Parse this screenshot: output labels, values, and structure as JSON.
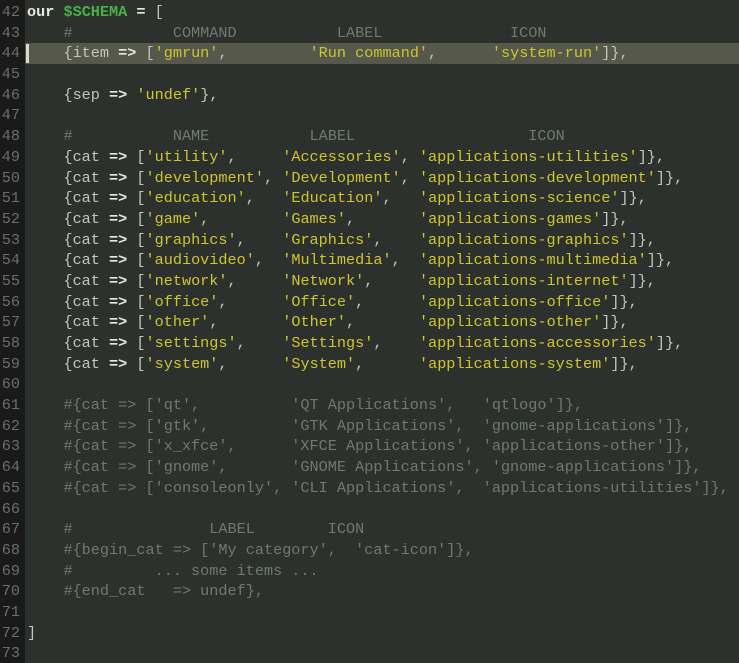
{
  "editor": {
    "current_line": "44",
    "colors": {
      "bg": "#2d312e",
      "gutter_bg": "#1a1a1a",
      "line_number": "#6b6f66",
      "default_text": "#c3c6ba",
      "keyword": "#e6e8de",
      "green_variable": "#46b246",
      "string_yellow": "#cfc52f",
      "comment": "#6f796f",
      "current_line_bg": "#55584a",
      "cursor": "#d9d9d2"
    },
    "lines": [
      {
        "num": "42",
        "segs": [
          [
            "our",
            "kw"
          ],
          [
            " ",
            ""
          ],
          [
            "$SCHEMA",
            "var"
          ],
          [
            " ",
            ""
          ],
          [
            "=",
            "kw"
          ],
          [
            " [",
            ""
          ]
        ]
      },
      {
        "num": "43",
        "segs": [
          [
            "    #           COMMAND           LABEL              ICON",
            "com"
          ]
        ]
      },
      {
        "num": "44",
        "segs": [
          [
            "    {item ",
            ""
          ],
          [
            "=>",
            "kw"
          ],
          [
            " [",
            ""
          ],
          [
            "'gmrun'",
            "str"
          ],
          [
            ",         ",
            ""
          ],
          [
            "'Run command'",
            "str"
          ],
          [
            ",      ",
            ""
          ],
          [
            "'system-run'",
            "str"
          ],
          [
            "]},",
            ""
          ]
        ]
      },
      {
        "num": "45",
        "segs": []
      },
      {
        "num": "46",
        "segs": [
          [
            "    {sep ",
            ""
          ],
          [
            "=>",
            "kw"
          ],
          [
            " ",
            ""
          ],
          [
            "'undef'",
            "str"
          ],
          [
            "},",
            ""
          ]
        ]
      },
      {
        "num": "47",
        "segs": []
      },
      {
        "num": "48",
        "segs": [
          [
            "    #           NAME           LABEL                   ICON",
            "com"
          ]
        ]
      },
      {
        "num": "49",
        "segs": [
          [
            "    {cat ",
            ""
          ],
          [
            "=>",
            "kw"
          ],
          [
            " [",
            ""
          ],
          [
            "'utility'",
            "str"
          ],
          [
            ",     ",
            ""
          ],
          [
            "'Accessories'",
            "str"
          ],
          [
            ", ",
            ""
          ],
          [
            "'applications-utilities'",
            "str"
          ],
          [
            "]},",
            ""
          ]
        ]
      },
      {
        "num": "50",
        "segs": [
          [
            "    {cat ",
            ""
          ],
          [
            "=>",
            "kw"
          ],
          [
            " [",
            ""
          ],
          [
            "'development'",
            "str"
          ],
          [
            ", ",
            ""
          ],
          [
            "'Development'",
            "str"
          ],
          [
            ", ",
            ""
          ],
          [
            "'applications-development'",
            "str"
          ],
          [
            "]},",
            ""
          ]
        ]
      },
      {
        "num": "51",
        "segs": [
          [
            "    {cat ",
            ""
          ],
          [
            "=>",
            "kw"
          ],
          [
            " [",
            ""
          ],
          [
            "'education'",
            "str"
          ],
          [
            ",   ",
            ""
          ],
          [
            "'Education'",
            "str"
          ],
          [
            ",   ",
            ""
          ],
          [
            "'applications-science'",
            "str"
          ],
          [
            "]},",
            ""
          ]
        ]
      },
      {
        "num": "52",
        "segs": [
          [
            "    {cat ",
            ""
          ],
          [
            "=>",
            "kw"
          ],
          [
            " [",
            ""
          ],
          [
            "'game'",
            "str"
          ],
          [
            ",        ",
            ""
          ],
          [
            "'Games'",
            "str"
          ],
          [
            ",       ",
            ""
          ],
          [
            "'applications-games'",
            "str"
          ],
          [
            "]},",
            ""
          ]
        ]
      },
      {
        "num": "53",
        "segs": [
          [
            "    {cat ",
            ""
          ],
          [
            "=>",
            "kw"
          ],
          [
            " [",
            ""
          ],
          [
            "'graphics'",
            "str"
          ],
          [
            ",    ",
            ""
          ],
          [
            "'Graphics'",
            "str"
          ],
          [
            ",    ",
            ""
          ],
          [
            "'applications-graphics'",
            "str"
          ],
          [
            "]},",
            ""
          ]
        ]
      },
      {
        "num": "54",
        "segs": [
          [
            "    {cat ",
            ""
          ],
          [
            "=>",
            "kw"
          ],
          [
            " [",
            ""
          ],
          [
            "'audiovideo'",
            "str"
          ],
          [
            ",  ",
            ""
          ],
          [
            "'Multimedia'",
            "str"
          ],
          [
            ",  ",
            ""
          ],
          [
            "'applications-multimedia'",
            "str"
          ],
          [
            "]},",
            ""
          ]
        ]
      },
      {
        "num": "55",
        "segs": [
          [
            "    {cat ",
            ""
          ],
          [
            "=>",
            "kw"
          ],
          [
            " [",
            ""
          ],
          [
            "'network'",
            "str"
          ],
          [
            ",     ",
            ""
          ],
          [
            "'Network'",
            "str"
          ],
          [
            ",     ",
            ""
          ],
          [
            "'applications-internet'",
            "str"
          ],
          [
            "]},",
            ""
          ]
        ]
      },
      {
        "num": "56",
        "segs": [
          [
            "    {cat ",
            ""
          ],
          [
            "=>",
            "kw"
          ],
          [
            " [",
            ""
          ],
          [
            "'office'",
            "str"
          ],
          [
            ",      ",
            ""
          ],
          [
            "'Office'",
            "str"
          ],
          [
            ",      ",
            ""
          ],
          [
            "'applications-office'",
            "str"
          ],
          [
            "]},",
            ""
          ]
        ]
      },
      {
        "num": "57",
        "segs": [
          [
            "    {cat ",
            ""
          ],
          [
            "=>",
            "kw"
          ],
          [
            " [",
            ""
          ],
          [
            "'other'",
            "str"
          ],
          [
            ",       ",
            ""
          ],
          [
            "'Other'",
            "str"
          ],
          [
            ",       ",
            ""
          ],
          [
            "'applications-other'",
            "str"
          ],
          [
            "]},",
            ""
          ]
        ]
      },
      {
        "num": "58",
        "segs": [
          [
            "    {cat ",
            ""
          ],
          [
            "=>",
            "kw"
          ],
          [
            " [",
            ""
          ],
          [
            "'settings'",
            "str"
          ],
          [
            ",    ",
            ""
          ],
          [
            "'Settings'",
            "str"
          ],
          [
            ",    ",
            ""
          ],
          [
            "'applications-accessories'",
            "str"
          ],
          [
            "]},",
            ""
          ]
        ]
      },
      {
        "num": "59",
        "segs": [
          [
            "    {cat ",
            ""
          ],
          [
            "=>",
            "kw"
          ],
          [
            " [",
            ""
          ],
          [
            "'system'",
            "str"
          ],
          [
            ",      ",
            ""
          ],
          [
            "'System'",
            "str"
          ],
          [
            ",      ",
            ""
          ],
          [
            "'applications-system'",
            "str"
          ],
          [
            "]},",
            ""
          ]
        ]
      },
      {
        "num": "60",
        "segs": []
      },
      {
        "num": "61",
        "segs": [
          [
            "    #{cat => ['qt',          'QT Applications',   'qtlogo']},",
            "com"
          ]
        ]
      },
      {
        "num": "62",
        "segs": [
          [
            "    #{cat => ['gtk',         'GTK Applications',  'gnome-applications']},",
            "com"
          ]
        ]
      },
      {
        "num": "63",
        "segs": [
          [
            "    #{cat => ['x_xfce',      'XFCE Applications', 'applications-other']},",
            "com"
          ]
        ]
      },
      {
        "num": "64",
        "segs": [
          [
            "    #{cat => ['gnome',       'GNOME Applications', 'gnome-applications']},",
            "com"
          ]
        ]
      },
      {
        "num": "65",
        "segs": [
          [
            "    #{cat => ['consoleonly', 'CLI Applications',  'applications-utilities']},",
            "com"
          ]
        ]
      },
      {
        "num": "66",
        "segs": []
      },
      {
        "num": "67",
        "segs": [
          [
            "    #               LABEL        ICON",
            "com"
          ]
        ]
      },
      {
        "num": "68",
        "segs": [
          [
            "    #{begin_cat => ['My category',  'cat-icon']},",
            "com"
          ]
        ]
      },
      {
        "num": "69",
        "segs": [
          [
            "    #         ... some items ...",
            "com"
          ]
        ]
      },
      {
        "num": "70",
        "segs": [
          [
            "    #{end_cat   => undef},",
            "com"
          ]
        ]
      },
      {
        "num": "71",
        "segs": []
      },
      {
        "num": "72",
        "segs": [
          [
            "]",
            ""
          ]
        ]
      },
      {
        "num": "73",
        "segs": []
      }
    ]
  }
}
